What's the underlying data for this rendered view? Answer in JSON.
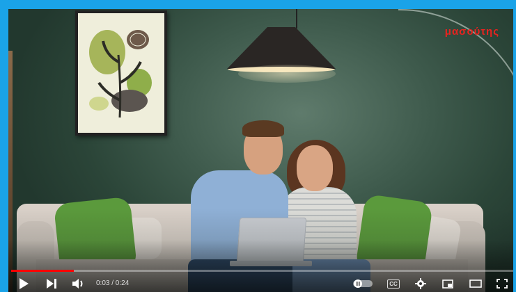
{
  "brand": {
    "logo_text": "μασούτης",
    "color": "#e8231f"
  },
  "player": {
    "time_display": "0:03 / 0:24",
    "progress_fraction": 0.125,
    "accent_color": "#ff0000",
    "controls": {
      "play": "play-icon",
      "next": "next-icon",
      "volume": "volume-icon",
      "autoplay": "autoplay-toggle-icon",
      "captions": "CC",
      "settings": "gear-icon",
      "miniplayer": "miniplayer-icon",
      "theater": "theater-mode-icon",
      "fullscreen": "fullscreen-icon"
    }
  }
}
